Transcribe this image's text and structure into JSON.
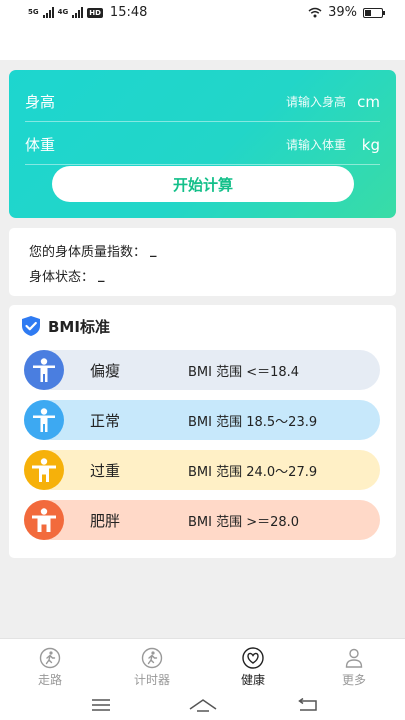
{
  "status": {
    "network_1": "5G",
    "network_2": "4G",
    "hd": "HD",
    "time": "15:48",
    "battery": "39%"
  },
  "form": {
    "height_label": "身高",
    "height_placeholder": "请输入身高",
    "height_unit": "cm",
    "weight_label": "体重",
    "weight_placeholder": "请输入体重",
    "weight_unit": "kg",
    "calculate_label": "开始计算"
  },
  "result": {
    "bmi_label": "您的身体质量指数：",
    "bmi_value": "_",
    "status_label": "身体状态：",
    "status_value": "_"
  },
  "standard": {
    "title": "BMI标准",
    "shield_icon": "shield-check-icon",
    "items": [
      {
        "name": "偏瘦",
        "range": "BMI 范围 <＝18.4",
        "icon": "person-icon",
        "color": "#4a7ee0",
        "bg": "#e6ecf4"
      },
      {
        "name": "正常",
        "range": "BMI 范围 18.5～23.9",
        "icon": "person-icon",
        "color": "#3da9f2",
        "bg": "#c7e8fb"
      },
      {
        "name": "过重",
        "range": "BMI 范围 24.0～27.9",
        "icon": "person-icon",
        "color": "#f6b10a",
        "bg": "#fff0c6"
      },
      {
        "name": "肥胖",
        "range": "BMI 范围 >＝28.0",
        "icon": "person-icon",
        "color": "#f26a3c",
        "bg": "#ffd9c8"
      }
    ]
  },
  "tabs": [
    {
      "label": "走路",
      "icon": "walk-icon",
      "active": false
    },
    {
      "label": "计时器",
      "icon": "walk-icon",
      "active": false
    },
    {
      "label": "健康",
      "icon": "heart-icon",
      "active": true
    },
    {
      "label": "更多",
      "icon": "person-outline-icon",
      "active": false
    }
  ],
  "colors": {
    "gradient_start": "#1dd6cf",
    "gradient_end": "#39dca6",
    "button_text": "#14c08a",
    "shield": "#2f7bf2"
  }
}
